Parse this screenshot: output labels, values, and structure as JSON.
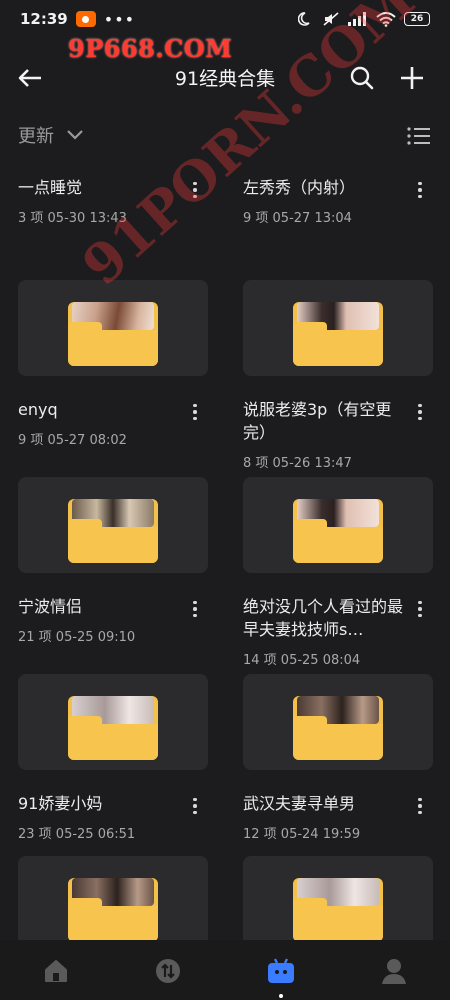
{
  "status_bar": {
    "time": "12:39",
    "dots": "•••",
    "battery": "26"
  },
  "watermark": {
    "top": "9P668.COM",
    "diagonal": "91PORN.COM"
  },
  "header": {
    "title": "91经典合集"
  },
  "sort": {
    "label": "更新"
  },
  "items": [
    {
      "name": "一点睡觉",
      "meta": "3 项  05-30 13:43",
      "photo": "none"
    },
    {
      "name": "左秀秀（内射）",
      "meta": "9 项  05-27 13:04",
      "photo": "none"
    },
    {
      "name": "enyq",
      "meta": "9 项  05-27 08:02",
      "photo": "warm"
    },
    {
      "name": "说服老婆3p（有空更完）",
      "meta": "8 项  05-26 13:47",
      "photo": "skin"
    },
    {
      "name": "宁波情侣",
      "meta": "21 项  05-25 09:10",
      "photo": "room"
    },
    {
      "name": "绝对没几个人看过的最早夫妻找技师s…",
      "meta": "14 项  05-25 08:04",
      "photo": "skin"
    },
    {
      "name": "91娇妻小妈",
      "meta": "23 项  05-25 06:51",
      "photo": "soft"
    },
    {
      "name": "武汉夫妻寻单男",
      "meta": "12 项  05-24 19:59",
      "photo": "dark"
    },
    {
      "name": "",
      "meta": "",
      "photo": "dark"
    },
    {
      "name": "",
      "meta": "",
      "photo": "soft"
    }
  ],
  "colors": {
    "folder": "#f3c04a",
    "accent": "#3b7cff",
    "watermark": "#ff3b30"
  },
  "nav": [
    {
      "icon": "home-icon",
      "active": false
    },
    {
      "icon": "transfer-icon",
      "active": false
    },
    {
      "icon": "collection-icon",
      "active": true
    },
    {
      "icon": "profile-icon",
      "active": false
    }
  ]
}
